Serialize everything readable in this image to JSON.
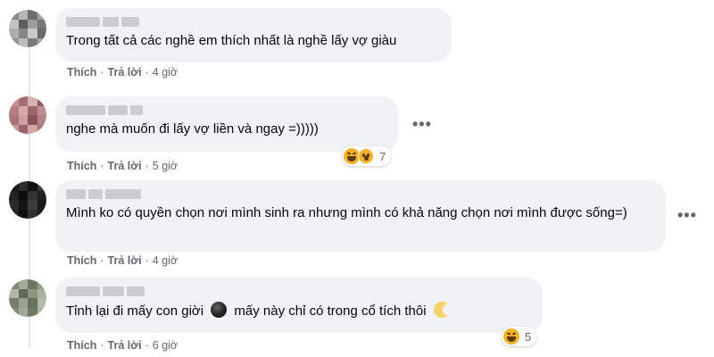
{
  "comments": [
    {
      "text": "Trong tất cả các nghề em thích nhất là nghề lấy vợ giàu",
      "actions": {
        "like": "Thích",
        "reply": "Trả lời",
        "separator": "·",
        "time": "4 giờ"
      },
      "avatar_colors": [
        "#8a8a8a",
        "#b7b7b7",
        "#6d6d6d",
        "#a3a3a3",
        "#c2c2c2",
        "#5e5e5e",
        "#9b9b9b",
        "#777",
        "#adadad",
        "#868686",
        "#c9c9c9",
        "#6a6a6a",
        "#959595",
        "#bdbdbd",
        "#7a7a7a",
        "#a8a8a8"
      ]
    },
    {
      "text": "nghe mà muốn đi lấy vợ liền và ngay =)))))",
      "actions": {
        "like": "Thích",
        "reply": "Trả lời",
        "separator": "·",
        "time": "5 giờ"
      },
      "reaction_count": "7",
      "reaction_icons": [
        "haha-icon",
        "wow-icon"
      ],
      "avatar_colors": [
        "#c98f8f",
        "#a86c73",
        "#d6b0b0",
        "#8e5a63",
        "#b97b82",
        "#d7a9a9",
        "#9c6670",
        "#c08a90",
        "#a97478",
        "#cf9e9e",
        "#87525c",
        "#b58287",
        "#c69599",
        "#9b646d",
        "#d2a4a6",
        "#ab7279"
      ]
    },
    {
      "text": "Mình ko có quyền chọn nơi mình sinh ra nhưng mình có khả năng chọn nơi mình được sống=)",
      "actions": {
        "like": "Thích",
        "reply": "Trả lời",
        "separator": "·",
        "time": "4 giờ"
      },
      "avatar_colors": [
        "#1a1a1a",
        "#2c2c2c",
        "#111",
        "#3a3a3a",
        "#222",
        "#0d0d0d",
        "#333",
        "#1f1f1f",
        "#2a2a2a",
        "#151515",
        "#3d3d3d",
        "#191919",
        "#262626",
        "#0f0f0f",
        "#303030",
        "#1c1c1c"
      ]
    },
    {
      "text_before": "Tỉnh lại đi mấy con giời",
      "text_middle": "mấy này chỉ có trong cổ tích thôi",
      "actions": {
        "like": "Thích",
        "reply": "Trả lời",
        "separator": "·",
        "time": "6 giờ"
      },
      "reaction_count": "5",
      "reaction_icons": [
        "haha-icon"
      ],
      "inline_icons": [
        "dark-face-emoji",
        "moon-face-emoji"
      ],
      "avatar_colors": [
        "#7f8a76",
        "#a2aa96",
        "#6c755f",
        "#94a087",
        "#b1b7a6",
        "#5e6853",
        "#8b9680",
        "#a9b29d",
        "#737d68",
        "#9aa48e",
        "#687260",
        "#b4baa8",
        "#828c77",
        "#9fa893",
        "#6f7a64",
        "#adb4a1"
      ]
    }
  ],
  "more_options": "•••"
}
